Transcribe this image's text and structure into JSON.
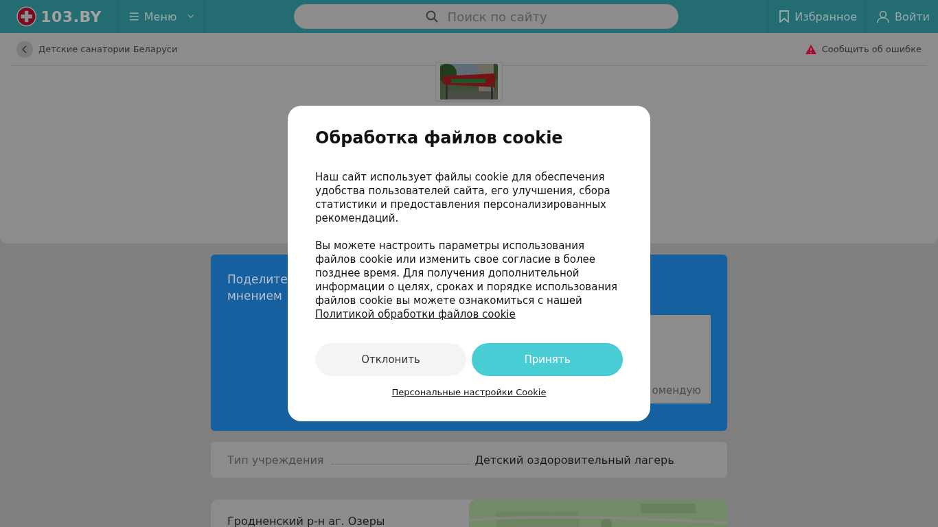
{
  "header": {
    "logo": "103.BY",
    "menu": "Меню",
    "search": {
      "placeholder": "Поиск по сайту"
    },
    "favorites": "Избранное",
    "login": "Войти"
  },
  "breadcrumb": {
    "back_label": "Детские санатории Беларуси",
    "report_error": "Сообщить об ошибке"
  },
  "review_card": {
    "title_lines": [
      "Поделите",
      "мнением"
    ],
    "textarea_placeholder": "омендую"
  },
  "info_rows": [
    {
      "label": "Тип учреждения",
      "value": "Детский оздоровительный лагерь"
    }
  ],
  "address": {
    "text": "Гродненский р-н аг. Озеры"
  },
  "cookie_dialog": {
    "title": "Обработка файлов cookie",
    "paragraphs": [
      "Наш сайт использует файлы cookie для обеспечения удобства пользователей сайта, его улучшения, сбора статистики и предоставления персонализированных рекомендаций.",
      "Вы можете настроить параметры использования файлов cookie или изменить свое согласие в более позднее время. Для получения дополнительной информации о целях, сроках и порядке использования файлов cookie вы можете ознакомиться с нашей"
    ],
    "policy_link": "Политикой обработки файлов cookie",
    "buttons": [
      {
        "label": "Отклонить",
        "kind": "secondary"
      },
      {
        "label": "Принять",
        "kind": "primary"
      }
    ],
    "settings_link": "Персональные настройки Cookie"
  }
}
